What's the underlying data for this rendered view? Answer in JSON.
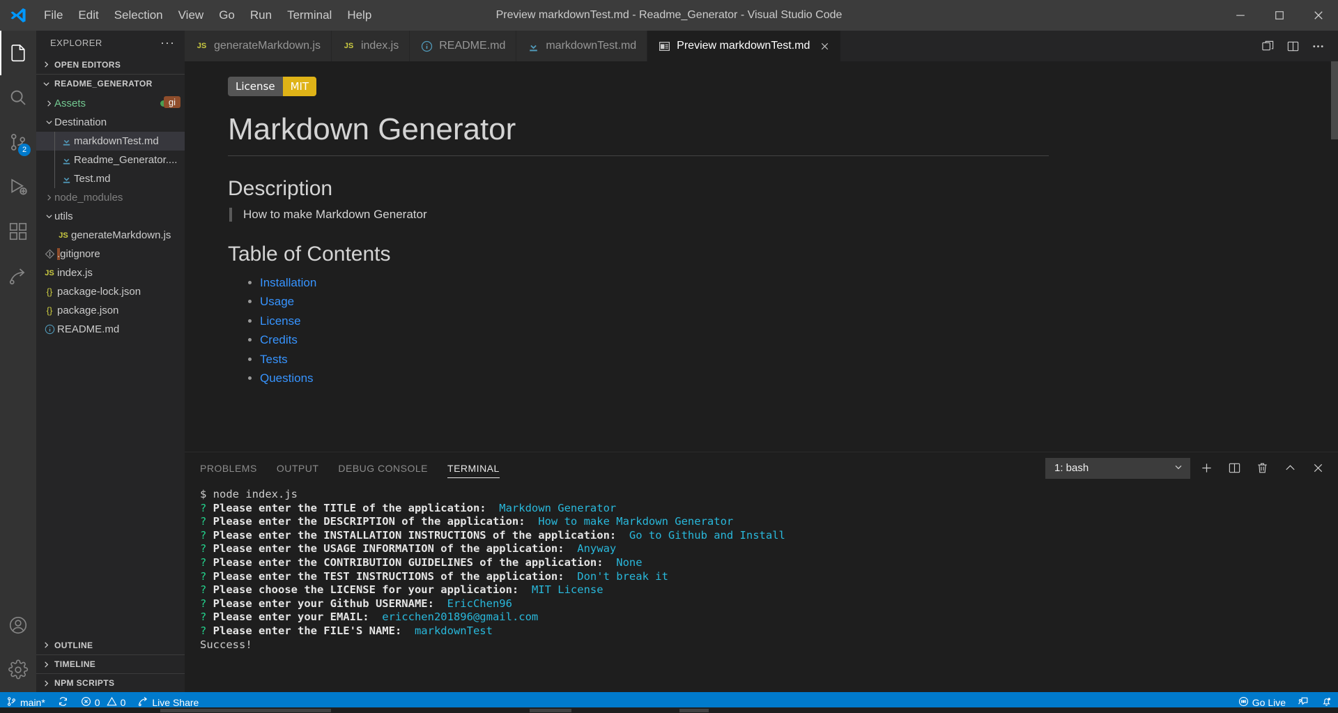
{
  "window": {
    "title": "Preview markdownTest.md - Readme_Generator - Visual Studio Code",
    "menu": [
      "File",
      "Edit",
      "Selection",
      "View",
      "Go",
      "Run",
      "Terminal",
      "Help"
    ],
    "controls": {
      "minimize": "minimize-icon",
      "maximize": "maximize-icon",
      "close": "close-icon"
    }
  },
  "activitybar": {
    "items": [
      {
        "name": "explorer",
        "icon": "files-icon",
        "badge": ""
      },
      {
        "name": "search",
        "icon": "search-icon",
        "badge": ""
      },
      {
        "name": "source-control",
        "icon": "source-control-icon",
        "badge": "2"
      },
      {
        "name": "run-and-debug",
        "icon": "debug-icon",
        "badge": ""
      },
      {
        "name": "extensions",
        "icon": "extensions-icon",
        "badge": ""
      },
      {
        "name": "live-share",
        "icon": "live-share-icon",
        "badge": ""
      }
    ],
    "bottom": [
      {
        "name": "accounts",
        "icon": "account-icon"
      },
      {
        "name": "settings",
        "icon": "gear-icon"
      }
    ]
  },
  "sidebar": {
    "title": "EXPLORER",
    "more_label": "···",
    "sections": {
      "open_editors": "OPEN EDITORS",
      "project": "README_GENERATOR",
      "outline": "OUTLINE",
      "timeline": "TIMELINE",
      "npm_scripts": "NPM SCRIPTS"
    },
    "tree": [
      {
        "label": "Assets",
        "type": "folder",
        "indent": 1,
        "expanded": false,
        "color": "green",
        "badge": "gi",
        "dot": true
      },
      {
        "label": "Destination",
        "type": "folder",
        "indent": 1,
        "expanded": true,
        "color": "normal"
      },
      {
        "label": "markdownTest.md",
        "type": "markdown",
        "indent": 2,
        "selected": true
      },
      {
        "label": "Readme_Generator....",
        "type": "markdown",
        "indent": 2
      },
      {
        "label": "Test.md",
        "type": "markdown",
        "indent": 2
      },
      {
        "label": "node_modules",
        "type": "folder",
        "indent": 1,
        "expanded": false,
        "color": "dim"
      },
      {
        "label": "utils",
        "type": "folder",
        "indent": 1,
        "expanded": true,
        "color": "normal"
      },
      {
        "label": "generateMarkdown.js",
        "type": "js",
        "indent": 2
      },
      {
        "label": ".gitignore",
        "type": "git",
        "indent": 1,
        "highlight": true
      },
      {
        "label": "index.js",
        "type": "js",
        "indent": 1
      },
      {
        "label": "package-lock.json",
        "type": "json",
        "indent": 1
      },
      {
        "label": "package.json",
        "type": "json",
        "indent": 1
      },
      {
        "label": "README.md",
        "type": "info",
        "indent": 1
      }
    ]
  },
  "editor": {
    "tabs": [
      {
        "label": "generateMarkdown.js",
        "icon": "js-icon",
        "active": false,
        "closable": false
      },
      {
        "label": "index.js",
        "icon": "js-icon",
        "active": false,
        "closable": false
      },
      {
        "label": "README.md",
        "icon": "info-icon",
        "active": false,
        "closable": false
      },
      {
        "label": "markdownTest.md",
        "icon": "markdown-icon",
        "active": false,
        "closable": false
      },
      {
        "label": "Preview markdownTest.md",
        "icon": "preview-icon",
        "active": true,
        "closable": true
      }
    ],
    "actions": [
      "split-preview-icon",
      "split-editor-icon",
      "more-actions-icon"
    ]
  },
  "preview": {
    "badge": {
      "left": "License",
      "right": "MIT"
    },
    "h1": "Markdown Generator",
    "description_heading": "Description",
    "description_text": "How to make Markdown Generator",
    "toc_heading": "Table of Contents",
    "toc": [
      "Installation",
      "Usage",
      "License",
      "Credits",
      "Tests",
      "Questions"
    ]
  },
  "panel": {
    "tabs": [
      "PROBLEMS",
      "OUTPUT",
      "DEBUG CONSOLE",
      "TERMINAL"
    ],
    "active_tab": "TERMINAL",
    "terminal_select": "1: bash",
    "actions": [
      "new-terminal-icon",
      "split-terminal-icon",
      "kill-terminal-icon",
      "maximize-panel-icon",
      "close-panel-icon"
    ],
    "terminal_lines": [
      {
        "segments": [
          {
            "text": "$ node index.js",
            "style": "plain"
          }
        ]
      },
      {
        "segments": [
          {
            "text": "? ",
            "style": "green"
          },
          {
            "text": "Please enter the TITLE of the application:",
            "style": "white"
          },
          {
            "text": "  Markdown Generator",
            "style": "cyan"
          }
        ]
      },
      {
        "segments": [
          {
            "text": "? ",
            "style": "green"
          },
          {
            "text": "Please enter the DESCRIPTION of the application:",
            "style": "white"
          },
          {
            "text": "  How to make Markdown Generator",
            "style": "cyan"
          }
        ]
      },
      {
        "segments": [
          {
            "text": "? ",
            "style": "green"
          },
          {
            "text": "Please enter the INSTALLATION INSTRUCTIONS of the application:",
            "style": "white"
          },
          {
            "text": "  Go to Github and Install",
            "style": "cyan"
          }
        ]
      },
      {
        "segments": [
          {
            "text": "? ",
            "style": "green"
          },
          {
            "text": "Please enter the USAGE INFORMATION of the application:",
            "style": "white"
          },
          {
            "text": "  Anyway",
            "style": "cyan"
          }
        ]
      },
      {
        "segments": [
          {
            "text": "? ",
            "style": "green"
          },
          {
            "text": "Please enter the CONTRIBUTION GUIDELINES of the application:",
            "style": "white"
          },
          {
            "text": "  None",
            "style": "cyan"
          }
        ]
      },
      {
        "segments": [
          {
            "text": "? ",
            "style": "green"
          },
          {
            "text": "Please enter the TEST INSTRUCTIONS of the application:",
            "style": "white"
          },
          {
            "text": "  Don't break it",
            "style": "cyan"
          }
        ]
      },
      {
        "segments": [
          {
            "text": "? ",
            "style": "green"
          },
          {
            "text": "Please choose the LICENSE for your application:",
            "style": "white"
          },
          {
            "text": "  MIT License",
            "style": "cyan"
          }
        ]
      },
      {
        "segments": [
          {
            "text": "? ",
            "style": "green"
          },
          {
            "text": "Please enter your Github USERNAME:",
            "style": "white"
          },
          {
            "text": "  EricChen96",
            "style": "cyan"
          }
        ]
      },
      {
        "segments": [
          {
            "text": "? ",
            "style": "green"
          },
          {
            "text": "Please enter your EMAIL:",
            "style": "white"
          },
          {
            "text": "  ericchen201896@gmail.com",
            "style": "cyan"
          }
        ]
      },
      {
        "segments": [
          {
            "text": "? ",
            "style": "green"
          },
          {
            "text": "Please enter the FILE'S NAME:",
            "style": "white"
          },
          {
            "text": "  markdownTest",
            "style": "cyan"
          }
        ]
      },
      {
        "segments": [
          {
            "text": "Success!",
            "style": "plain"
          }
        ]
      }
    ]
  },
  "statusbar": {
    "branch": "main*",
    "sync_icon": "sync-icon",
    "errors": "0",
    "warnings": "0",
    "live_share": "Live Share",
    "go_live": "Go Live",
    "accent": "#007acc"
  }
}
